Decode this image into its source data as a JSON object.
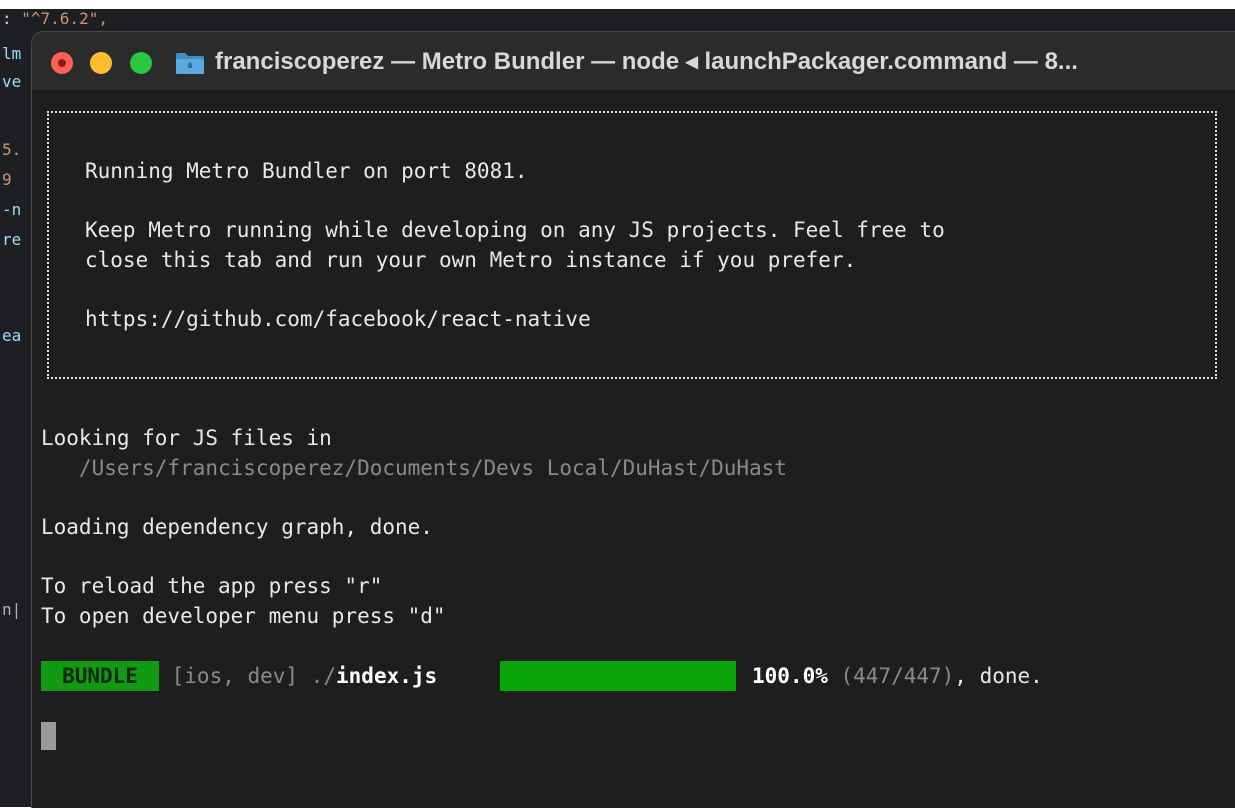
{
  "background_editor": {
    "top_line_prefix": ": ",
    "top_line_string": "\"^7.6.2\",",
    "fragments": [
      "lm",
      "ve",
      "5.",
      "9",
      "-n",
      "re",
      "ea",
      "n|"
    ]
  },
  "window": {
    "title": "franciscoperez — Metro Bundler — node ◂ launchPackager.command — 8...",
    "traffic_lights": [
      "close-icon",
      "minimize-icon",
      "zoom-icon"
    ],
    "title_icon": "folder-icon"
  },
  "terminal": {
    "banner": {
      "line1": "Running Metro Bundler on port 8081.",
      "line2": "Keep Metro running while developing on any JS projects. Feel free to",
      "line3": "close this tab and run your own Metro instance if you prefer.",
      "line4": "https://github.com/facebook/react-native"
    },
    "looking_for": "Looking for JS files in",
    "project_path": "   /Users/franciscoperez/Documents/Devs Local/DuHast/DuHast",
    "loading": "Loading dependency graph, done.",
    "reload_hint": "To reload the app press \"r\"",
    "menu_hint": "To open developer menu press \"d\"",
    "bundle": {
      "badge": "BUNDLE",
      "platform": " [ios, dev] ./",
      "entry": "index.js",
      "progress_fraction": 1.0,
      "percent": "100.0%",
      "count": " (447/447)",
      "status": ", done."
    }
  },
  "colors": {
    "close": "#fe5f57",
    "minimize": "#febc2e",
    "zoom": "#28c840",
    "bundle_green": "#129a12",
    "progress_green": "#08a408"
  }
}
